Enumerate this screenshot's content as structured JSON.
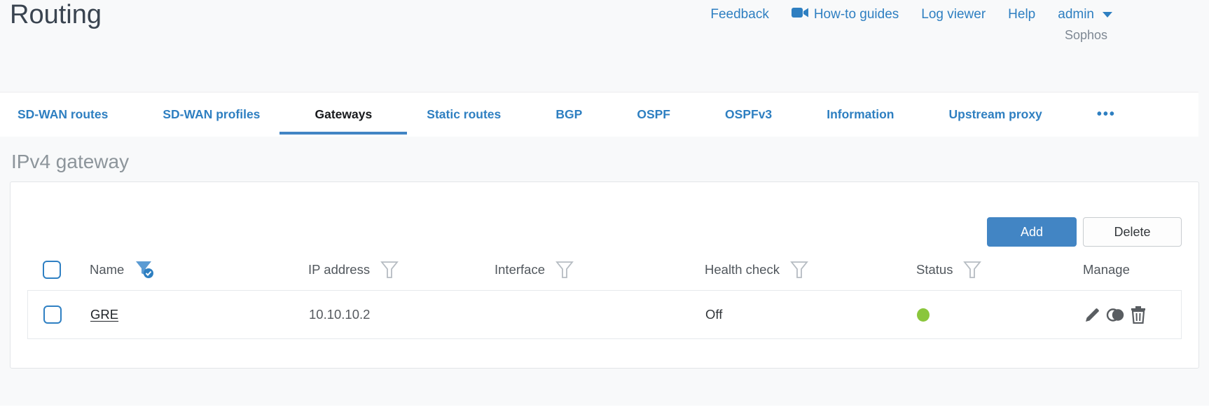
{
  "page": {
    "title": "Routing",
    "brand": "Sophos"
  },
  "top_nav": {
    "feedback": "Feedback",
    "howto_guides": "How-to guides",
    "log_viewer": "Log viewer",
    "help": "Help",
    "user": "admin"
  },
  "tabs": {
    "items": [
      {
        "label": "SD-WAN routes",
        "active": false
      },
      {
        "label": "SD-WAN profiles",
        "active": false
      },
      {
        "label": "Gateways",
        "active": true
      },
      {
        "label": "Static routes",
        "active": false
      },
      {
        "label": "BGP",
        "active": false
      },
      {
        "label": "OSPF",
        "active": false
      },
      {
        "label": "OSPFv3",
        "active": false
      },
      {
        "label": "Information",
        "active": false
      },
      {
        "label": "Upstream proxy",
        "active": false
      }
    ],
    "more_label": "•••"
  },
  "section": {
    "heading": "IPv4 gateway"
  },
  "toolbar": {
    "add": "Add",
    "delete": "Delete"
  },
  "table": {
    "columns": [
      {
        "label": "Name",
        "filter": "active"
      },
      {
        "label": "IP address",
        "filter": "inactive"
      },
      {
        "label": "Interface",
        "filter": "inactive"
      },
      {
        "label": "Health check",
        "filter": "inactive"
      },
      {
        "label": "Status",
        "filter": "inactive"
      },
      {
        "label": "Manage",
        "filter": "none"
      }
    ],
    "rows": [
      {
        "name": "GRE",
        "ip_address": "10.10.10.2",
        "interface": "",
        "health_check": "Off",
        "status_dot_color": "#8ac63c",
        "manage_actions": [
          "edit",
          "clone",
          "delete"
        ]
      }
    ]
  },
  "colors": {
    "link_blue": "#2e7fc1",
    "button_blue": "#4285c4",
    "active_tab_underline": "#4285c4",
    "status_green": "#8ac63c",
    "heading_gray": "#8d959b"
  }
}
